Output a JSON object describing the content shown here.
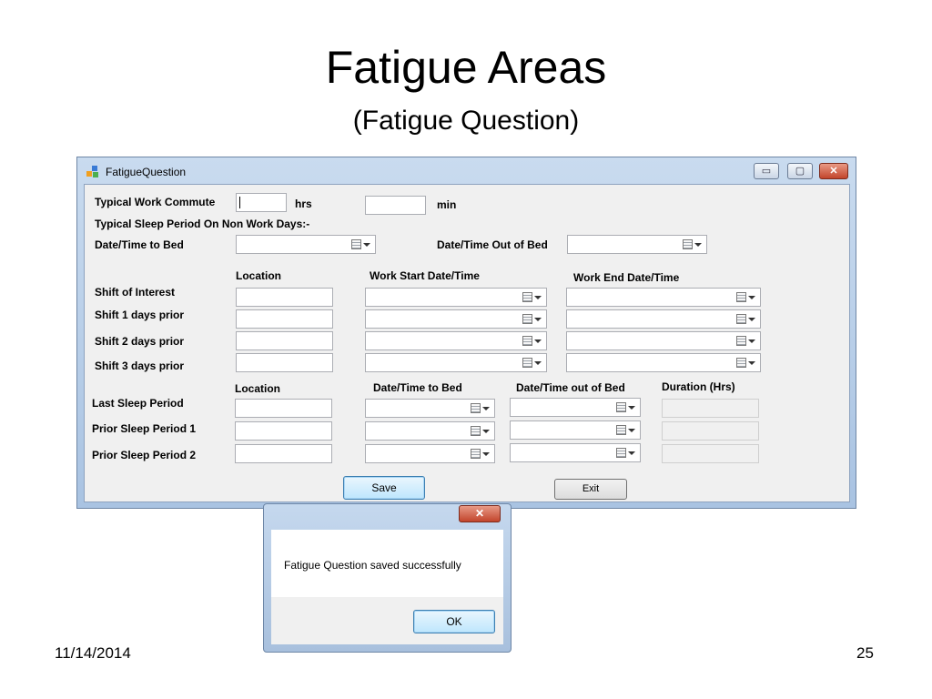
{
  "slide": {
    "title": "Fatigue Areas",
    "subtitle": "(Fatigue Question)",
    "date": "11/14/2014",
    "page_number": "25"
  },
  "window": {
    "title": "FatigueQuestion",
    "minimize": "▭",
    "maximize": "▢",
    "close": "✕"
  },
  "form": {
    "commute_label": "Typical Work Commute",
    "commute_hrs_value": "",
    "hrs_unit": "hrs",
    "commute_min_value": "",
    "min_unit": "min",
    "sleep_nonwork_label": "Typical Sleep Period On Non Work Days:-",
    "to_bed_label": "Date/Time to Bed",
    "out_of_bed_label": "Date/Time Out of Bed",
    "shifts": {
      "headers": [
        "Location",
        "Work Start Date/Time",
        "Work End Date/Time"
      ],
      "rows": [
        {
          "label": "Shift of Interest",
          "location": "",
          "start": "",
          "end": ""
        },
        {
          "label": "Shift  1 days prior",
          "location": "",
          "start": "",
          "end": ""
        },
        {
          "label": "Shift  2 days prior",
          "location": "",
          "start": "",
          "end": ""
        },
        {
          "label": "Shift  3 days prior",
          "location": "",
          "start": "",
          "end": ""
        }
      ]
    },
    "sleep": {
      "headers": [
        "Location",
        "Date/Time to Bed",
        "Date/Time out of Bed",
        "Duration (Hrs)"
      ],
      "rows": [
        {
          "label": "Last Sleep Period",
          "location": "",
          "to_bed": "",
          "out_of_bed": "",
          "duration": ""
        },
        {
          "label": "Prior Sleep Period 1",
          "location": "",
          "to_bed": "",
          "out_of_bed": "",
          "duration": ""
        },
        {
          "label": "Prior Sleep Period 2",
          "location": "",
          "to_bed": "",
          "out_of_bed": "",
          "duration": ""
        }
      ]
    },
    "save_label": "Save",
    "exit_label": "Exit"
  },
  "dialog": {
    "close": "✕",
    "message": "Fatigue Question saved successfully",
    "ok_label": "OK"
  }
}
